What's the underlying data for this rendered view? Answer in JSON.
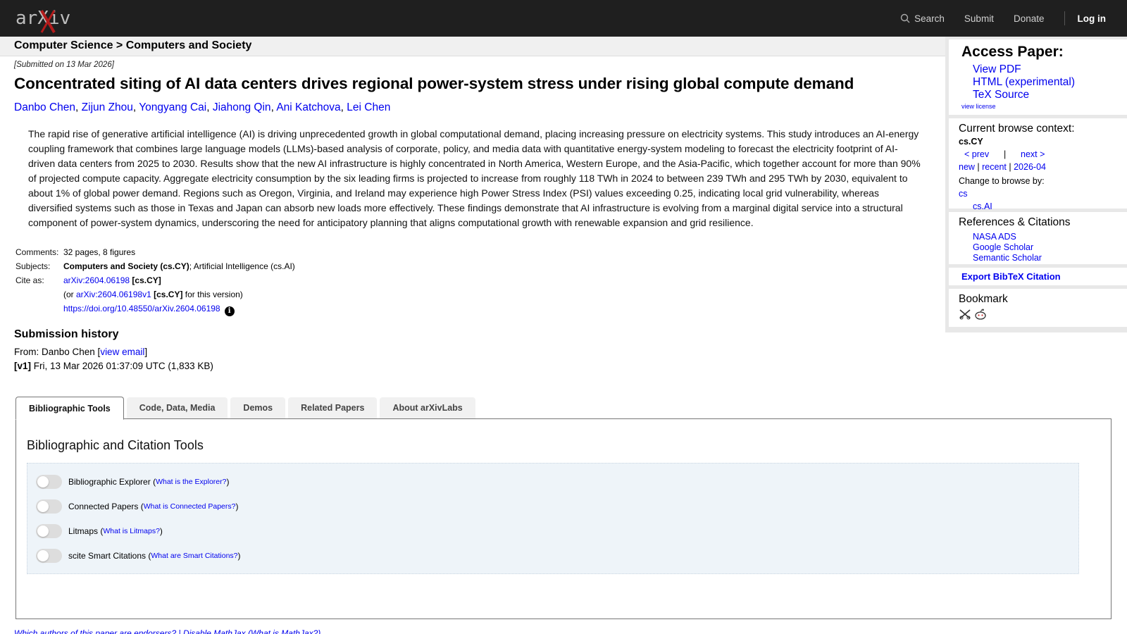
{
  "brand": {
    "logo_text": "arXiv"
  },
  "nav": {
    "search": "Search",
    "submit": "Submit",
    "donate": "Donate",
    "login": "Log in"
  },
  "breadcrumb": {
    "text": "Computer Science > Computers and Society"
  },
  "paper": {
    "submitted": "[Submitted on 13 Mar 2026]",
    "title": "Concentrated siting of AI data centers drives regional power-system stress under rising global compute demand",
    "authors": [
      "Danbo Chen",
      "Zijun Zhou",
      "Yongyang Cai",
      "Jiahong Qin",
      "Ani Katchova",
      "Lei Chen"
    ],
    "abstract": "The rapid rise of generative artificial intelligence (AI) is driving unprecedented growth in global computational demand, placing increasing pressure on electricity systems. This study introduces an AI-energy coupling framework that combines large language models (LLMs)-based analysis of corporate, policy, and media data with quantitative energy-system modeling to forecast the electricity footprint of AI-driven data centers from 2025 to 2030. Results show that the new AI infrastructure is highly concentrated in North America, Western Europe, and the Asia-Pacific, which together account for more than 90% of projected compute capacity. Aggregate electricity consumption by the six leading firms is projected to increase from roughly 118 TWh in 2024 to between 239 TWh and 295 TWh by 2030, equivalent to about 1% of global power demand. Regions such as Oregon, Virginia, and Ireland may experience high Power Stress Index (PSI) values exceeding 0.25, indicating local grid vulnerability, whereas diversified systems such as those in Texas and Japan can absorb new loads more effectively. These findings demonstrate that AI infrastructure is evolving from a marginal digital service into a structural component of power-system dynamics, underscoring the need for anticipatory planning that aligns computational growth with renewable expansion and grid resilience."
  },
  "meta": {
    "comments_label": "Comments:",
    "comments": "32 pages, 8 figures",
    "subjects_label": "Subjects:",
    "subjects_primary": "Computers and Society (cs.CY)",
    "subjects_rest": "; Artificial Intelligence (cs.AI)",
    "cite_label": "Cite as:",
    "cite_id": "arXiv:2604.06198",
    "cite_cat": "[cs.CY]",
    "version_pre": "(or ",
    "version_id": "arXiv:2604.06198v1",
    "version_cat": "[cs.CY]",
    "version_post": " for this version)",
    "doi": "https://doi.org/10.48550/arXiv.2604.06198",
    "info_icon": "i"
  },
  "history": {
    "heading": "Submission history",
    "from_pre": "From: Danbo Chen [",
    "view_email": "view email",
    "from_post": "]",
    "v1_tag": "[v1]",
    "v1_text": " Fri, 13 Mar 2026 01:37:09 UTC (1,833 KB)"
  },
  "sidebar": {
    "access_heading": "Access Paper:",
    "access_links": [
      "View PDF",
      "HTML (experimental)",
      "TeX Source"
    ],
    "view_license": "view license",
    "context_heading": "Current browse context:",
    "context_value": "cs.CY",
    "prev": "< prev",
    "sep": "|",
    "next": "next >",
    "new": "new",
    "recent": "recent",
    "date": "2026-04",
    "change_label": "Change to browse by:",
    "browse_cs": "cs",
    "browse_csai": "cs.AI",
    "refs_heading": "References & Citations",
    "refs_links": [
      "NASA ADS",
      "Google Scholar",
      "Semantic Scholar"
    ],
    "bibtex": "Export BibTeX Citation",
    "bookmark_heading": "Bookmark"
  },
  "tabs": [
    "Bibliographic Tools",
    "Code, Data, Media",
    "Demos",
    "Related Papers",
    "About arXivLabs"
  ],
  "panel": {
    "heading": "Bibliographic and Citation Tools",
    "toggles": [
      {
        "label": "Bibliographic Explorer",
        "link": "What is the Explorer?"
      },
      {
        "label": "Connected Papers",
        "link": "What is Connected Papers?"
      },
      {
        "label": "Litmaps",
        "link": "What is Litmaps?"
      },
      {
        "label": "scite Smart Citations",
        "link": "What are Smart Citations?"
      }
    ]
  },
  "footer": {
    "text": "Which authors of this paper are endorsers? | Disable MathJax (What is MathJax?)"
  }
}
